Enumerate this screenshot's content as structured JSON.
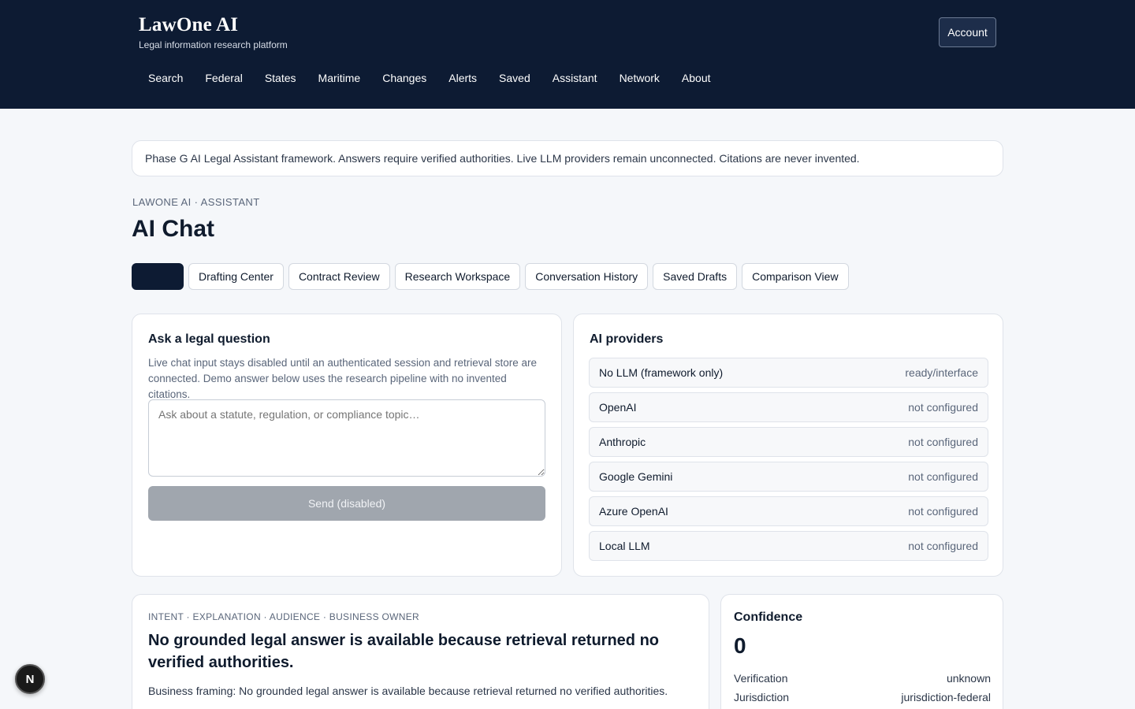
{
  "header": {
    "title": "LawOne AI",
    "subtitle": "Legal information research platform",
    "account_label": "Account",
    "nav": [
      "Search",
      "Federal",
      "States",
      "Maritime",
      "Changes",
      "Alerts",
      "Saved",
      "Assistant",
      "Network",
      "About"
    ]
  },
  "notice": "Phase G AI Legal Assistant framework. Answers require verified authorities. Live LLM providers remain unconnected. Citations are never invented.",
  "eyebrow": "LAWONE AI · ASSISTANT",
  "page_title": "AI Chat",
  "tabs": [
    "",
    "Drafting Center",
    "Contract Review",
    "Research Workspace",
    "Conversation History",
    "Saved Drafts",
    "Comparison View"
  ],
  "ask": {
    "title": "Ask a legal question",
    "description": "Live chat input stays disabled until an authenticated session and retrieval store are connected. Demo answer below uses the research pipeline with no invented citations.",
    "placeholder": "Ask about a statute, regulation, or compliance topic…",
    "send_label": "Send (disabled)"
  },
  "providers": {
    "title": "AI providers",
    "items": [
      {
        "name": "No LLM (framework only)",
        "status": "ready/interface"
      },
      {
        "name": "OpenAI",
        "status": "not configured"
      },
      {
        "name": "Anthropic",
        "status": "not configured"
      },
      {
        "name": "Google Gemini",
        "status": "not configured"
      },
      {
        "name": "Azure OpenAI",
        "status": "not configured"
      },
      {
        "name": "Local LLM",
        "status": "not configured"
      }
    ]
  },
  "answer": {
    "eyebrow": "INTENT · EXPLANATION · AUDIENCE · BUSINESS OWNER",
    "headline": "No grounded legal answer is available because retrieval returned no verified authorities.",
    "body": "Business framing: No grounded legal answer is available because retrieval returned no verified authorities."
  },
  "confidence": {
    "title": "Confidence",
    "value": "0",
    "rows": [
      {
        "label": "Verification",
        "value": "unknown"
      },
      {
        "label": "Jurisdiction",
        "value": "jurisdiction-federal"
      }
    ]
  },
  "badge_letter": "N"
}
